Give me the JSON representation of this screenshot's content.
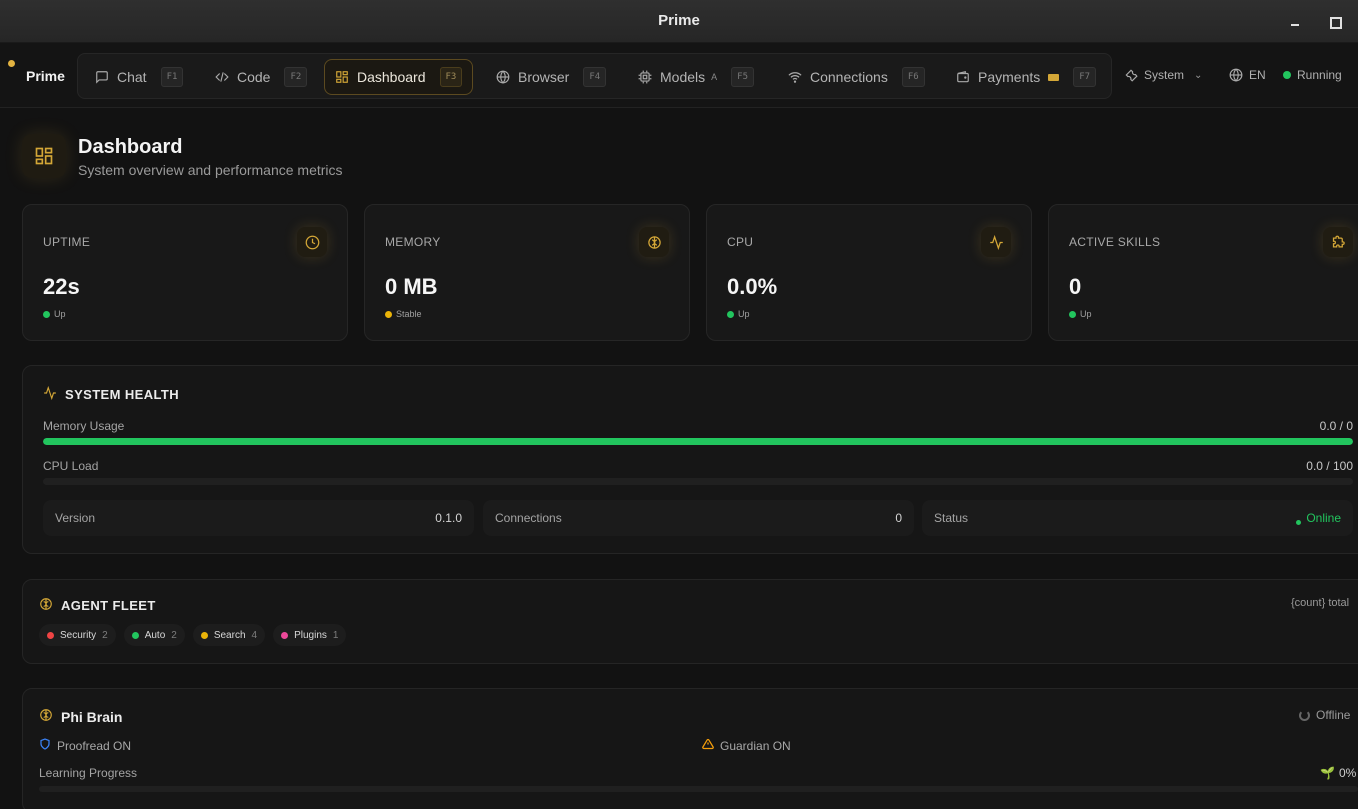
{
  "window": {
    "title": "Prime"
  },
  "brand": {
    "name": "Prime"
  },
  "nav": {
    "items": [
      {
        "label": "Chat",
        "key": "F1",
        "icon": "chat-icon"
      },
      {
        "label": "Code",
        "key": "F2",
        "icon": "code-icon"
      },
      {
        "label": "Dashboard",
        "key": "F3",
        "icon": "dashboard-icon",
        "active": true
      },
      {
        "label": "Browser",
        "key": "F4",
        "icon": "globe-icon"
      },
      {
        "label": "Models",
        "sub": "A",
        "key": "F5",
        "icon": "cpu-icon"
      },
      {
        "label": "Connections",
        "key": "F6",
        "icon": "wifi-icon"
      },
      {
        "label": "Payments",
        "key": "F7",
        "icon": "wallet-icon"
      }
    ],
    "system_label": "System",
    "language": "EN",
    "status": "Running"
  },
  "header": {
    "title": "Dashboard",
    "subtitle": "System overview and performance metrics"
  },
  "stats": [
    {
      "label": "UPTIME",
      "value": "22s",
      "trend": "Up",
      "trend_color": "#22c55e",
      "icon": "clock-icon"
    },
    {
      "label": "MEMORY",
      "value": "0 MB",
      "trend": "Stable",
      "trend_color": "#eab308",
      "icon": "brain-icon"
    },
    {
      "label": "CPU",
      "value": "0.0%",
      "trend": "Up",
      "trend_color": "#22c55e",
      "icon": "activity-icon"
    },
    {
      "label": "ACTIVE SKILLS",
      "value": "0",
      "trend": "Up",
      "trend_color": "#22c55e",
      "icon": "puzzle-icon"
    }
  ],
  "health": {
    "title": "SYSTEM HEALTH",
    "memory": {
      "label": "Memory Usage",
      "value": "0.0 / 0",
      "fill_fraction": 1.0
    },
    "cpu": {
      "label": "CPU Load",
      "value": "0.0 / 100",
      "fill_fraction": 0.0
    },
    "info": [
      {
        "key": "Version",
        "value": "0.1.0"
      },
      {
        "key": "Connections",
        "value": "0"
      },
      {
        "key": "Status",
        "value": "Online"
      }
    ]
  },
  "fleet": {
    "title": "AGENT FLEET",
    "total": "{count} total",
    "chips": [
      {
        "label": "Security",
        "count": "2",
        "color": "#ef4444"
      },
      {
        "label": "Auto",
        "count": "2",
        "color": "#22c55e"
      },
      {
        "label": "Search",
        "count": "4",
        "color": "#eab308"
      },
      {
        "label": "Plugins",
        "count": "1",
        "color": "#ec4899"
      }
    ]
  },
  "phi": {
    "title": "Phi Brain",
    "status": "Offline",
    "proofread": "Proofread ON",
    "guardian": "Guardian ON",
    "learning_label": "Learning Progress",
    "learning_value": "0%",
    "learning_fraction": 0.0
  },
  "colors": {
    "accent": "#d4a737",
    "success": "#22c55e",
    "warning": "#eab308"
  }
}
